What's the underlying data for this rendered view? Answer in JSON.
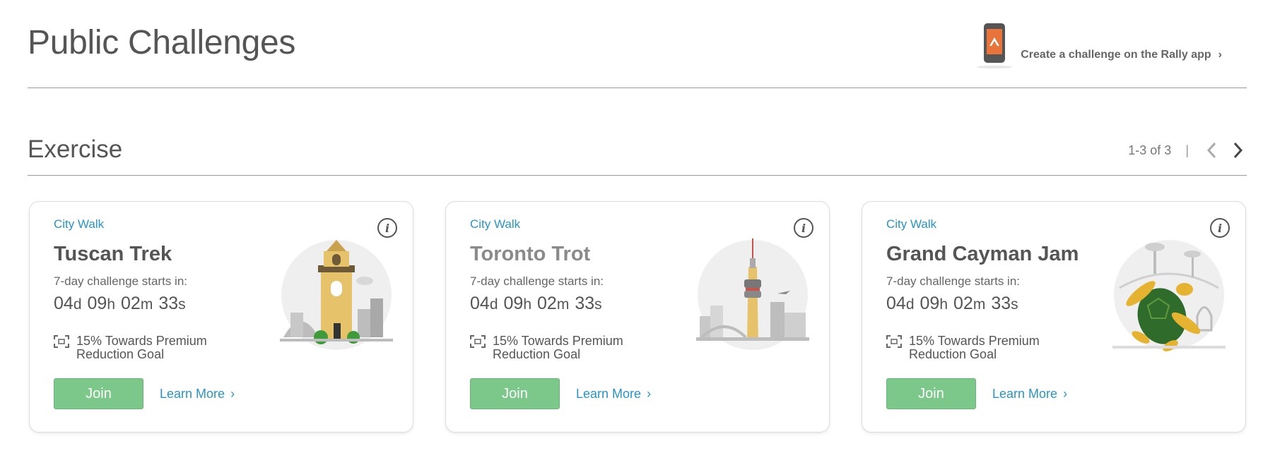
{
  "header": {
    "title": "Public Challenges",
    "promo_text": "Create a challenge on the Rally app",
    "promo_chevron": "›"
  },
  "section": {
    "title": "Exercise",
    "range": "1-3 of 3",
    "separator": "|"
  },
  "colors": {
    "link": "#2a93c9",
    "join_button": "#7cc88b",
    "rally_orange": "#e8743b"
  },
  "cards": [
    {
      "category": "City Walk",
      "name": "Tuscan Trek",
      "starts_label": "7-day challenge starts in:",
      "countdown": {
        "d": "04",
        "h": "09",
        "m": "02",
        "s": "33"
      },
      "goal": "15% Towards Premium Reduction Goal",
      "join_label": "Join",
      "learn_label": "Learn More",
      "chevron": "›",
      "info_icon": "i",
      "art": "tuscan-tower-illustration"
    },
    {
      "category": "City Walk",
      "name": "Toronto Trot",
      "starts_label": "7-day challenge starts in:",
      "countdown": {
        "d": "04",
        "h": "09",
        "m": "02",
        "s": "33"
      },
      "goal": "15% Towards Premium Reduction Goal",
      "join_label": "Join",
      "learn_label": "Learn More",
      "chevron": "›",
      "info_icon": "i",
      "art": "cn-tower-illustration"
    },
    {
      "category": "City Walk",
      "name": "Grand Cayman Jam",
      "starts_label": "7-day challenge starts in:",
      "countdown": {
        "d": "04",
        "h": "09",
        "m": "02",
        "s": "33"
      },
      "goal": "15% Towards Premium Reduction Goal",
      "join_label": "Join",
      "learn_label": "Learn More",
      "chevron": "›",
      "info_icon": "i",
      "art": "sea-turtle-illustration"
    }
  ],
  "units": {
    "d": "d",
    "h": "h",
    "m": "m",
    "s": "s"
  }
}
